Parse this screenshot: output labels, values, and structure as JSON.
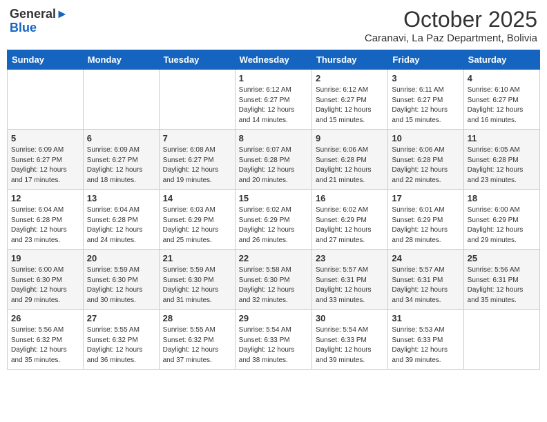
{
  "header": {
    "logo_general": "General",
    "logo_blue": "Blue",
    "month_title": "October 2025",
    "location": "Caranavi, La Paz Department, Bolivia"
  },
  "weekdays": [
    "Sunday",
    "Monday",
    "Tuesday",
    "Wednesday",
    "Thursday",
    "Friday",
    "Saturday"
  ],
  "weeks": [
    [
      {
        "day": "",
        "info": ""
      },
      {
        "day": "",
        "info": ""
      },
      {
        "day": "",
        "info": ""
      },
      {
        "day": "1",
        "info": "Sunrise: 6:12 AM\nSunset: 6:27 PM\nDaylight: 12 hours\nand 14 minutes."
      },
      {
        "day": "2",
        "info": "Sunrise: 6:12 AM\nSunset: 6:27 PM\nDaylight: 12 hours\nand 15 minutes."
      },
      {
        "day": "3",
        "info": "Sunrise: 6:11 AM\nSunset: 6:27 PM\nDaylight: 12 hours\nand 15 minutes."
      },
      {
        "day": "4",
        "info": "Sunrise: 6:10 AM\nSunset: 6:27 PM\nDaylight: 12 hours\nand 16 minutes."
      }
    ],
    [
      {
        "day": "5",
        "info": "Sunrise: 6:09 AM\nSunset: 6:27 PM\nDaylight: 12 hours\nand 17 minutes."
      },
      {
        "day": "6",
        "info": "Sunrise: 6:09 AM\nSunset: 6:27 PM\nDaylight: 12 hours\nand 18 minutes."
      },
      {
        "day": "7",
        "info": "Sunrise: 6:08 AM\nSunset: 6:27 PM\nDaylight: 12 hours\nand 19 minutes."
      },
      {
        "day": "8",
        "info": "Sunrise: 6:07 AM\nSunset: 6:28 PM\nDaylight: 12 hours\nand 20 minutes."
      },
      {
        "day": "9",
        "info": "Sunrise: 6:06 AM\nSunset: 6:28 PM\nDaylight: 12 hours\nand 21 minutes."
      },
      {
        "day": "10",
        "info": "Sunrise: 6:06 AM\nSunset: 6:28 PM\nDaylight: 12 hours\nand 22 minutes."
      },
      {
        "day": "11",
        "info": "Sunrise: 6:05 AM\nSunset: 6:28 PM\nDaylight: 12 hours\nand 23 minutes."
      }
    ],
    [
      {
        "day": "12",
        "info": "Sunrise: 6:04 AM\nSunset: 6:28 PM\nDaylight: 12 hours\nand 23 minutes."
      },
      {
        "day": "13",
        "info": "Sunrise: 6:04 AM\nSunset: 6:28 PM\nDaylight: 12 hours\nand 24 minutes."
      },
      {
        "day": "14",
        "info": "Sunrise: 6:03 AM\nSunset: 6:29 PM\nDaylight: 12 hours\nand 25 minutes."
      },
      {
        "day": "15",
        "info": "Sunrise: 6:02 AM\nSunset: 6:29 PM\nDaylight: 12 hours\nand 26 minutes."
      },
      {
        "day": "16",
        "info": "Sunrise: 6:02 AM\nSunset: 6:29 PM\nDaylight: 12 hours\nand 27 minutes."
      },
      {
        "day": "17",
        "info": "Sunrise: 6:01 AM\nSunset: 6:29 PM\nDaylight: 12 hours\nand 28 minutes."
      },
      {
        "day": "18",
        "info": "Sunrise: 6:00 AM\nSunset: 6:29 PM\nDaylight: 12 hours\nand 29 minutes."
      }
    ],
    [
      {
        "day": "19",
        "info": "Sunrise: 6:00 AM\nSunset: 6:30 PM\nDaylight: 12 hours\nand 29 minutes."
      },
      {
        "day": "20",
        "info": "Sunrise: 5:59 AM\nSunset: 6:30 PM\nDaylight: 12 hours\nand 30 minutes."
      },
      {
        "day": "21",
        "info": "Sunrise: 5:59 AM\nSunset: 6:30 PM\nDaylight: 12 hours\nand 31 minutes."
      },
      {
        "day": "22",
        "info": "Sunrise: 5:58 AM\nSunset: 6:30 PM\nDaylight: 12 hours\nand 32 minutes."
      },
      {
        "day": "23",
        "info": "Sunrise: 5:57 AM\nSunset: 6:31 PM\nDaylight: 12 hours\nand 33 minutes."
      },
      {
        "day": "24",
        "info": "Sunrise: 5:57 AM\nSunset: 6:31 PM\nDaylight: 12 hours\nand 34 minutes."
      },
      {
        "day": "25",
        "info": "Sunrise: 5:56 AM\nSunset: 6:31 PM\nDaylight: 12 hours\nand 35 minutes."
      }
    ],
    [
      {
        "day": "26",
        "info": "Sunrise: 5:56 AM\nSunset: 6:32 PM\nDaylight: 12 hours\nand 35 minutes."
      },
      {
        "day": "27",
        "info": "Sunrise: 5:55 AM\nSunset: 6:32 PM\nDaylight: 12 hours\nand 36 minutes."
      },
      {
        "day": "28",
        "info": "Sunrise: 5:55 AM\nSunset: 6:32 PM\nDaylight: 12 hours\nand 37 minutes."
      },
      {
        "day": "29",
        "info": "Sunrise: 5:54 AM\nSunset: 6:33 PM\nDaylight: 12 hours\nand 38 minutes."
      },
      {
        "day": "30",
        "info": "Sunrise: 5:54 AM\nSunset: 6:33 PM\nDaylight: 12 hours\nand 39 minutes."
      },
      {
        "day": "31",
        "info": "Sunrise: 5:53 AM\nSunset: 6:33 PM\nDaylight: 12 hours\nand 39 minutes."
      },
      {
        "day": "",
        "info": ""
      }
    ]
  ]
}
